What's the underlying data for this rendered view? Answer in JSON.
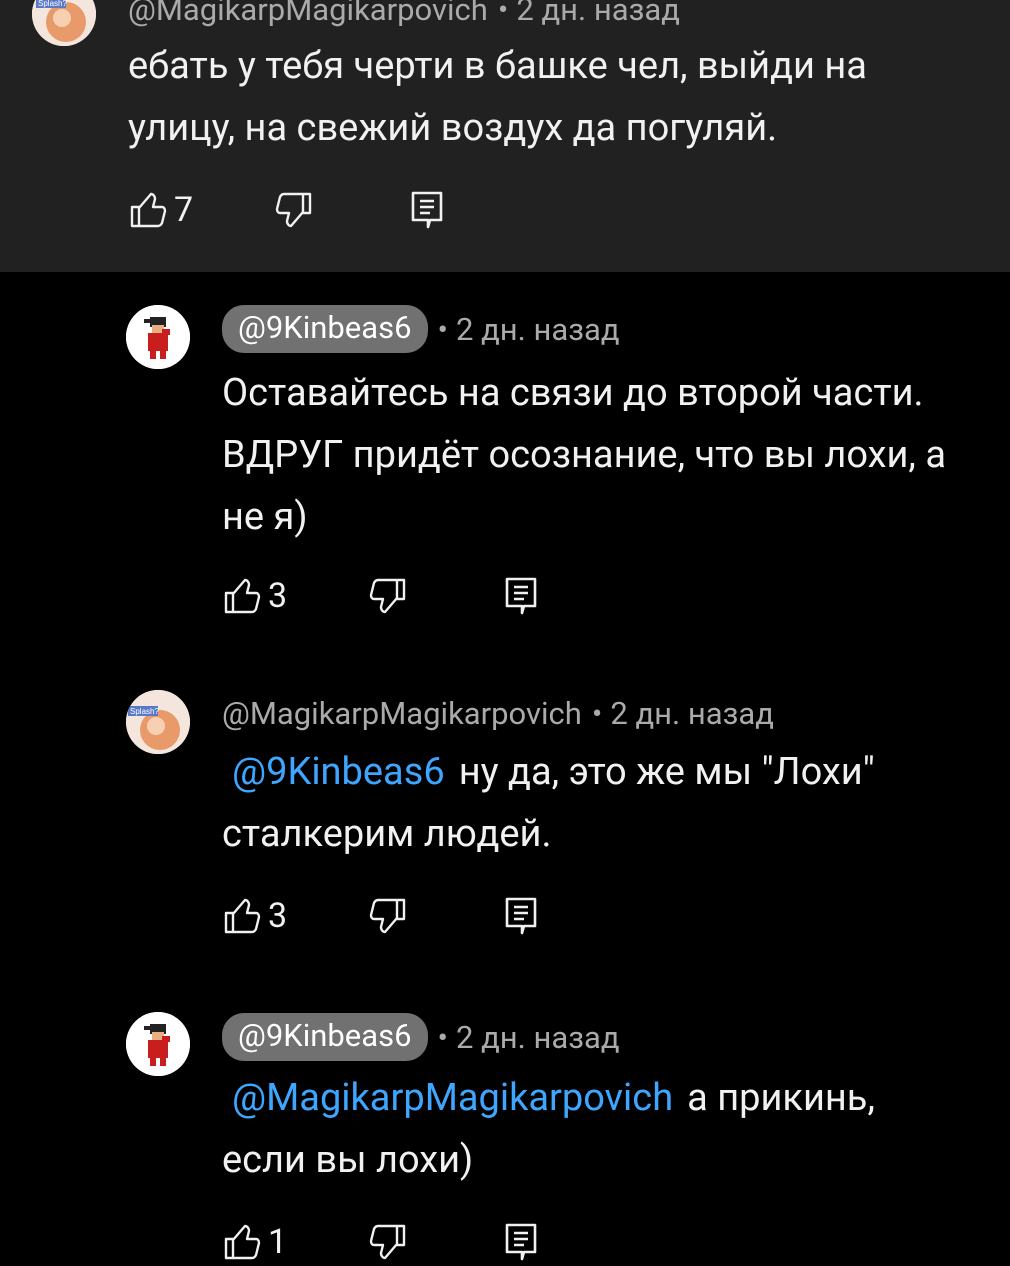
{
  "comments": [
    {
      "author": "@MagikarpMagikarpovich",
      "time": "2 дн. назад",
      "mention": "",
      "text": "ебать у тебя черти в башке чел, выйди на улицу, на свежий воздух да погуляй.",
      "likes": "7"
    },
    {
      "author": "@9Kinbeas6",
      "time": "2 дн. назад",
      "mention": "",
      "text": "Оставайтесь на связи до второй части. ВДРУГ придёт осознание, что вы лохи, а не я)",
      "likes": "3"
    },
    {
      "author": "@MagikarpMagikarpovich",
      "time": "2 дн. назад",
      "mention": "@9Kinbeas6",
      "text": "ну да, это же мы \"Лохи\" сталкерим людей.",
      "likes": "3"
    },
    {
      "author": "@9Kinbeas6",
      "time": "2 дн. назад",
      "mention": "@MagikarpMagikarpovich",
      "text": "а прикинь, если вы лохи)",
      "likes": "1"
    }
  ],
  "separator": "•",
  "avatar_label": "Splash?",
  "colors": {
    "background": "#000000",
    "highlight_background": "#212121",
    "text": "#f1f1f1",
    "meta": "#aaaaaa",
    "author_chip": "#717171",
    "mention": "#3ea6ff"
  },
  "icons": [
    "like-icon",
    "dislike-icon",
    "reply-icon"
  ]
}
